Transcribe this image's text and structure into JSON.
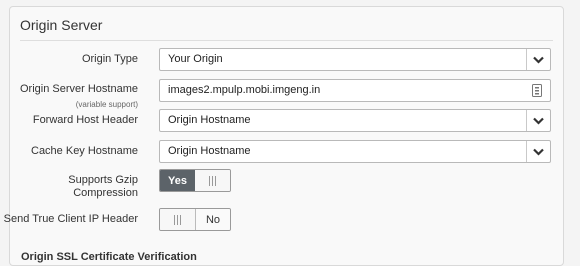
{
  "panel": {
    "title": "Origin Server"
  },
  "fields": {
    "origin_type": {
      "label": "Origin Type",
      "value": "Your Origin"
    },
    "origin_hostname": {
      "label": "Origin Server Hostname",
      "sublabel": "(variable support)",
      "value": "images2.mpulp.mobi.imgeng.in"
    },
    "forward_host_header": {
      "label": "Forward Host Header",
      "value": "Origin Hostname"
    },
    "cache_key_hostname": {
      "label": "Cache Key Hostname",
      "value": "Origin Hostname"
    },
    "gzip": {
      "label_line1": "Supports Gzip",
      "label_line2": "Compression",
      "value": "Yes"
    },
    "true_client_ip": {
      "label": "Send True Client IP Header",
      "value": "No"
    }
  },
  "next_section": {
    "title": "Origin SSL Certificate Verification"
  },
  "icons": {
    "chevron": "chevron-down-icon",
    "document": "document-icon"
  }
}
